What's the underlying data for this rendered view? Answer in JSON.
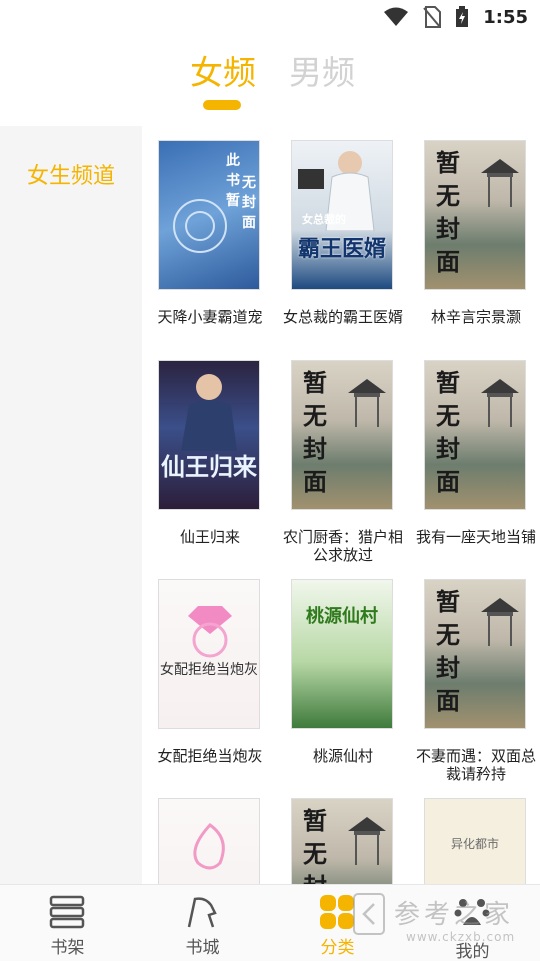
{
  "status_bar": {
    "time": "1:55"
  },
  "gender_tabs": {
    "female": "女频",
    "male": "男频",
    "active": "female"
  },
  "sidebar": {
    "items": [
      {
        "label": "女生频道",
        "active": true
      }
    ]
  },
  "books": [
    {
      "title": "天降小妻霸道宠",
      "cover_text": "此书暂无封面",
      "cover_style": "blue-placeholder"
    },
    {
      "title": "女总裁的霸王医婿",
      "cover_text": "霸王医婿",
      "cover_subtext": "女总裁的",
      "cover_style": "doctor"
    },
    {
      "title": "林辛言宗景灏",
      "cover_text": "暂无封面",
      "cover_style": "pavilion-placeholder"
    },
    {
      "title": "仙王归来",
      "cover_text": "仙王归来",
      "cover_style": "xian"
    },
    {
      "title": "农门厨香：猎户相公求放过",
      "cover_text": "暂无封面",
      "cover_style": "pavilion-placeholder"
    },
    {
      "title": "我有一座天地当铺",
      "cover_text": "暂无封面",
      "cover_style": "pavilion-placeholder"
    },
    {
      "title": "女配拒绝当炮灰",
      "cover_text": "女配拒绝当炮灰",
      "cover_style": "pink"
    },
    {
      "title": "桃源仙村",
      "cover_text": "桃源仙村",
      "cover_style": "peach"
    },
    {
      "title": "不妻而遇：双面总裁请矜持",
      "cover_text": "暂无封面",
      "cover_style": "pavilion-placeholder"
    },
    {
      "title": "",
      "cover_text": "",
      "cover_style": "pink-phoenix"
    },
    {
      "title": "",
      "cover_text": "暂无封面",
      "cover_style": "pavilion-placeholder"
    },
    {
      "title": "",
      "cover_text": "异化都市",
      "cover_style": "plain"
    }
  ],
  "bottom_nav": [
    {
      "label": "书架",
      "icon": "bookshelf-icon"
    },
    {
      "label": "书城",
      "icon": "bookstore-icon"
    },
    {
      "label": "分类",
      "icon": "category-icon",
      "active": true
    },
    {
      "label": "我的",
      "icon": "profile-icon"
    }
  ],
  "watermark": {
    "text": "参考之家",
    "url": "www.ckzxb.com"
  },
  "colors": {
    "accent": "#f5b400",
    "inactive_tab": "#d2d2d2",
    "sidebar_bg": "#f5f5f5"
  }
}
